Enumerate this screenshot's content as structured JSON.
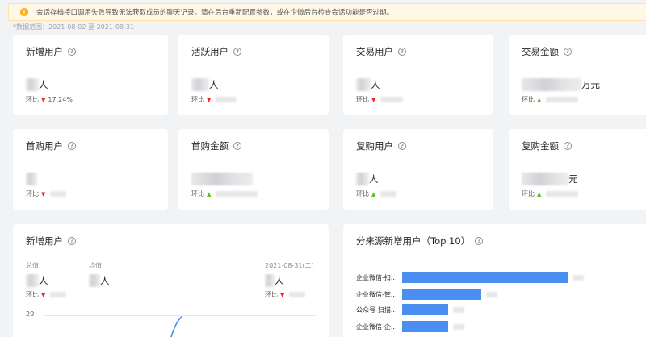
{
  "alert": {
    "text": "会话存档接口调用失败导致无法获取成员的聊天记录。请在后台重新配置参数，或在企微后台检查会话功能是否过期。"
  },
  "date_range": "*数据范围：2021-08-02 至 2021-08-31",
  "labels": {
    "ratio": "环比",
    "unit_person": "人",
    "unit_wan": "万元"
  },
  "stats_row1": [
    {
      "title": "新增用户",
      "ratio_value": "17.24%",
      "trend": "down"
    },
    {
      "title": "活跃用户",
      "trend": "down"
    },
    {
      "title": "交易用户",
      "trend": "down"
    },
    {
      "title": "交易金额",
      "trend": "up"
    }
  ],
  "stats_row2": [
    {
      "title": "首购用户",
      "trend": "down"
    },
    {
      "title": "首购金额",
      "trend": "up"
    },
    {
      "title": "复购用户",
      "trend": "up"
    },
    {
      "title": "复购金额",
      "trend": "up",
      "unit_partial": "元"
    }
  ],
  "chart_card": {
    "title": "新增用户",
    "total_label": "总值",
    "avg_label": "均值",
    "date_label": "2021-08-31(二)",
    "y_tick": "20"
  },
  "source_card": {
    "title": "分来源新增用户（Top 10）",
    "bars": [
      {
        "label": "企业微信-扫...",
        "value": 100
      },
      {
        "label": "企业微信-管...",
        "value": 48
      },
      {
        "label": "公众号-扫描...",
        "value": 28
      },
      {
        "label": "企业微信-企...",
        "value": 28
      }
    ]
  },
  "colors": {
    "bar": "#4a8ef1",
    "down": "#f5222d",
    "up": "#52c41a",
    "alert_bg": "#fff8e6"
  }
}
